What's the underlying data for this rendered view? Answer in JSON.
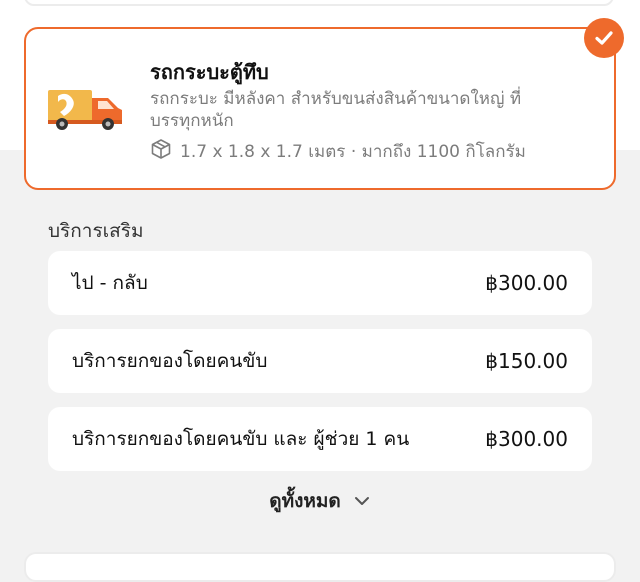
{
  "vehicle": {
    "name": "รถกระบะตู้ทึบ",
    "description": "รถกระบะ มีหลังคา สำหรับขนส่งสินค้าขนาดใหญ่ ที่บรรทุกหนัก",
    "spec": "1.7 x 1.8 x 1.7 เมตร · มากถึง 1100 กิโลกรัม",
    "selected": true,
    "icon": "box-icon"
  },
  "additional_services": {
    "title": "บริการเสริม",
    "items": [
      {
        "label": "ไป - กลับ",
        "price": "฿300.00"
      },
      {
        "label": "บริการยกของโดยคนขับ",
        "price": "฿150.00"
      },
      {
        "label": "บริการยกของโดยคนขับ และ ผู้ช่วย 1 คน",
        "price": "฿300.00"
      }
    ],
    "see_all_label": "ดูทั้งหมด"
  },
  "colors": {
    "accent": "#ee6a2c",
    "background": "#f2f2f2",
    "card": "#ffffff",
    "muted_text": "#7c7c7c"
  }
}
